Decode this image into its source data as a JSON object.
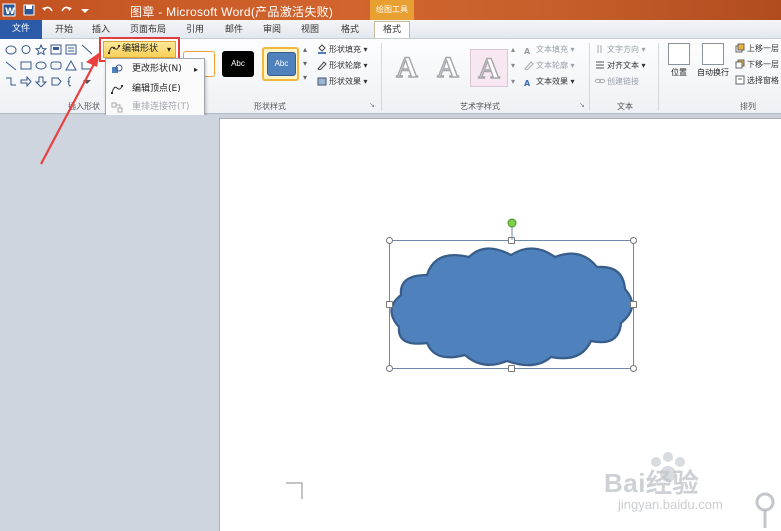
{
  "window": {
    "title": "图章 - Microsoft Word(产品激活失败)",
    "contextual_tools_label": "绘图工具"
  },
  "tabs": [
    {
      "label": "文件"
    },
    {
      "label": "开始"
    },
    {
      "label": "插入"
    },
    {
      "label": "页面布局"
    },
    {
      "label": "引用"
    },
    {
      "label": "邮件"
    },
    {
      "label": "审阅"
    },
    {
      "label": "视图"
    },
    {
      "label": "格式"
    },
    {
      "label": "格式"
    }
  ],
  "ribbon": {
    "insert_shapes_group": "插入形状",
    "edit_shape_label": "编辑形状",
    "shape_styles_group": "形状样式",
    "style_samples": [
      "Abc",
      "Abc"
    ],
    "shape_fill": "形状填充",
    "shape_outline": "形状轮廓",
    "shape_effects": "形状效果",
    "wordart_group": "艺术字样式",
    "wordart_samples": [
      "A",
      "A",
      "A"
    ],
    "text_fill": "文本填充",
    "text_outline": "文本轮廓",
    "text_effects": "文本效果",
    "text_group": "文本",
    "text_direction": "文字方向",
    "align_text": "对齐文本",
    "create_link": "创建链接",
    "position": "位置",
    "wrap_text": "自动换行",
    "bring_forward": "上移一层",
    "send_backward": "下移一层",
    "selection_pane": "选择窗格",
    "arrange_group": "排列"
  },
  "dropdown": {
    "items": [
      {
        "label": "更改形状(N)",
        "has_submenu": true,
        "disabled": false
      },
      {
        "label": "编辑顶点(E)",
        "has_submenu": false,
        "disabled": false
      },
      {
        "label": "重排连接符(T)",
        "has_submenu": false,
        "disabled": true
      }
    ]
  },
  "watermark": {
    "brand": "Bai经验",
    "url": "jingyan.baidu.com"
  },
  "colors": {
    "title_bar": "#c75f2c",
    "file_tab": "#2a5aa8",
    "shape_fill": "#4f81bd",
    "shape_stroke": "#385d8a",
    "highlight_box": "#e33c3c"
  }
}
